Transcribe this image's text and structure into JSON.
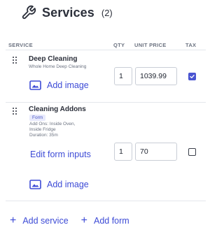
{
  "header": {
    "title": "Services",
    "count": "(2)"
  },
  "table": {
    "columns": {
      "service": "SERVICE",
      "qty": "QTY",
      "unit_price": "UNIT PRICE",
      "tax": "TAX"
    }
  },
  "items": [
    {
      "name": "Deep Cleaning",
      "subtitle": "Whole Home Deep Cleaning",
      "add_image_label": "Add image",
      "qty": "1",
      "unit_price": "1039.99",
      "tax_checked": true
    },
    {
      "name": "Cleaning Addons",
      "badge": "Form",
      "details_line1": "Add Ons: Inside Oven,",
      "details_line2": "Inside Fridge",
      "details_line3": "Duration: 35m",
      "edit_form_label": "Edit form inputs",
      "add_image_label": "Add image",
      "qty": "1",
      "unit_price": "70",
      "tax_checked": false
    }
  ],
  "footer": {
    "add_service_label": "Add service",
    "add_form_label": "Add form"
  },
  "colors": {
    "accent": "#3d4bd6",
    "checkbox": "#4a55d1"
  }
}
